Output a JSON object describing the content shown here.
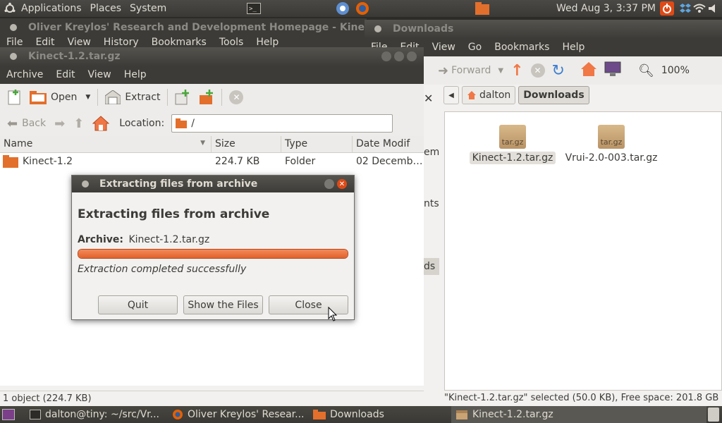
{
  "top_panel": {
    "menus": [
      "Applications",
      "Places",
      "System"
    ],
    "clock": "Wed Aug  3,  3:37 PM"
  },
  "browser_window": {
    "title": "Oliver Kreylos' Research and Development Homepage - Kinect Hac",
    "menus": [
      "File",
      "Edit",
      "View",
      "History",
      "Bookmarks",
      "Tools",
      "Help"
    ]
  },
  "archive_window": {
    "title": "Kinect-1.2.tar.gz",
    "menus": [
      "Archive",
      "Edit",
      "View",
      "Help"
    ],
    "toolbar": {
      "open": "Open",
      "extract": "Extract"
    },
    "nav": {
      "back": "Back",
      "location_label": "Location:",
      "location_value": "/"
    },
    "columns": [
      "Name",
      "Size",
      "Type",
      "Date Modif"
    ],
    "rows": [
      {
        "name": "Kinect-1.2",
        "size": "224.7 KB",
        "type": "Folder",
        "date": "02 Decemb…"
      }
    ],
    "status": "1 object (224.7 KB)"
  },
  "downloads_window": {
    "title": "Downloads",
    "menus": [
      "File",
      "Edit",
      "View",
      "Go",
      "Bookmarks",
      "Help"
    ],
    "toolbar": {
      "forward": "Forward",
      "zoom": "100%"
    },
    "breadcrumb": [
      "dalton",
      "Downloads"
    ],
    "sidebar_fragments": [
      "em",
      "nts",
      "ds"
    ],
    "files": [
      {
        "name": "Kinect-1.2.tar.gz",
        "icon_label": "tar.gz",
        "selected": true
      },
      {
        "name": "Vrui-2.0-003.tar.gz",
        "icon_label": "tar.gz",
        "selected": false
      }
    ],
    "status": "\"Kinect-1.2.tar.gz\" selected (50.0 KB), Free space: 201.8 GB"
  },
  "dialog": {
    "title": "Extracting files from archive",
    "heading": "Extracting files from archive",
    "archive_label": "Archive:",
    "archive_name": "Kinect-1.2.tar.gz",
    "progress": 1.0,
    "message": "Extraction completed successfully",
    "buttons": {
      "quit": "Quit",
      "show": "Show the Files",
      "close": "Close"
    }
  },
  "taskbar": {
    "tasks": [
      {
        "label": "dalton@tiny: ~/src/Vr...",
        "icon": "terminal-icon"
      },
      {
        "label": "Oliver Kreylos' Resear...",
        "icon": "firefox-icon"
      },
      {
        "label": "Downloads",
        "icon": "folder-icon"
      },
      {
        "label": "Kinect-1.2.tar.gz",
        "icon": "archive-icon"
      }
    ]
  },
  "colors": {
    "accent_orange": "#f07746",
    "panel_dark": "#3c3b37",
    "close_red": "#df4a16"
  }
}
